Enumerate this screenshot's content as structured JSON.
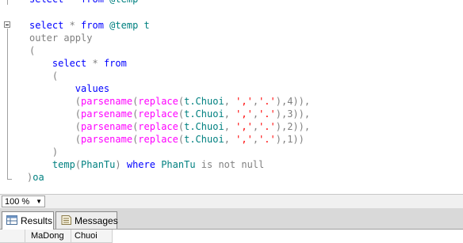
{
  "editor": {
    "lines": [
      {
        "indent": "",
        "tokens": [
          {
            "t": "select",
            "c": "kw"
          },
          {
            "t": " * ",
            "c": "gr"
          },
          {
            "t": "from",
            "c": "kw"
          },
          {
            "t": " @temp",
            "c": "tl"
          }
        ]
      },
      {
        "indent": "",
        "tokens": [
          {
            "t": "select",
            "c": "kw"
          },
          {
            "t": " * ",
            "c": "gr"
          },
          {
            "t": "from",
            "c": "kw"
          },
          {
            "t": " @temp t",
            "c": "tl"
          }
        ]
      },
      {
        "indent": "",
        "tokens": [
          {
            "t": "outer apply",
            "c": "gr"
          }
        ]
      },
      {
        "indent": "",
        "tokens": [
          {
            "t": "(",
            "c": "gr"
          }
        ]
      },
      {
        "indent": "    ",
        "tokens": [
          {
            "t": "select",
            "c": "kw"
          },
          {
            "t": " * ",
            "c": "gr"
          },
          {
            "t": "from",
            "c": "kw"
          }
        ]
      },
      {
        "indent": "    ",
        "tokens": [
          {
            "t": "(",
            "c": "gr"
          }
        ]
      },
      {
        "indent": "        ",
        "tokens": [
          {
            "t": "values",
            "c": "kw"
          }
        ]
      },
      {
        "indent": "        ",
        "tokens": [
          {
            "t": "(",
            "c": "gr"
          },
          {
            "t": "parsename",
            "c": "fn"
          },
          {
            "t": "(",
            "c": "gr"
          },
          {
            "t": "replace",
            "c": "fn"
          },
          {
            "t": "(",
            "c": "gr"
          },
          {
            "t": "t.Chuoi",
            "c": "tl"
          },
          {
            "t": ", ",
            "c": "gr"
          },
          {
            "t": "','",
            "c": "st"
          },
          {
            "t": ",",
            "c": "gr"
          },
          {
            "t": "'.'",
            "c": "st"
          },
          {
            "t": "),4)),",
            "c": "gr"
          }
        ]
      },
      {
        "indent": "        ",
        "tokens": [
          {
            "t": "(",
            "c": "gr"
          },
          {
            "t": "parsename",
            "c": "fn"
          },
          {
            "t": "(",
            "c": "gr"
          },
          {
            "t": "replace",
            "c": "fn"
          },
          {
            "t": "(",
            "c": "gr"
          },
          {
            "t": "t.Chuoi",
            "c": "tl"
          },
          {
            "t": ", ",
            "c": "gr"
          },
          {
            "t": "','",
            "c": "st"
          },
          {
            "t": ",",
            "c": "gr"
          },
          {
            "t": "'.'",
            "c": "st"
          },
          {
            "t": "),3)),",
            "c": "gr"
          }
        ]
      },
      {
        "indent": "        ",
        "tokens": [
          {
            "t": "(",
            "c": "gr"
          },
          {
            "t": "parsename",
            "c": "fn"
          },
          {
            "t": "(",
            "c": "gr"
          },
          {
            "t": "replace",
            "c": "fn"
          },
          {
            "t": "(",
            "c": "gr"
          },
          {
            "t": "t.Chuoi",
            "c": "tl"
          },
          {
            "t": ", ",
            "c": "gr"
          },
          {
            "t": "','",
            "c": "st"
          },
          {
            "t": ",",
            "c": "gr"
          },
          {
            "t": "'.'",
            "c": "st"
          },
          {
            "t": "),2)),",
            "c": "gr"
          }
        ]
      },
      {
        "indent": "        ",
        "tokens": [
          {
            "t": "(",
            "c": "gr"
          },
          {
            "t": "parsename",
            "c": "fn"
          },
          {
            "t": "(",
            "c": "gr"
          },
          {
            "t": "replace",
            "c": "fn"
          },
          {
            "t": "(",
            "c": "gr"
          },
          {
            "t": "t.Chuoi",
            "c": "tl"
          },
          {
            "t": ", ",
            "c": "gr"
          },
          {
            "t": "','",
            "c": "st"
          },
          {
            "t": ",",
            "c": "gr"
          },
          {
            "t": "'.'",
            "c": "st"
          },
          {
            "t": "),1))",
            "c": "gr"
          }
        ]
      },
      {
        "indent": "    ",
        "tokens": [
          {
            "t": ")",
            "c": "gr"
          }
        ]
      },
      {
        "indent": "    ",
        "tokens": [
          {
            "t": "temp",
            "c": "tl"
          },
          {
            "t": "(",
            "c": "gr"
          },
          {
            "t": "PhanTu",
            "c": "tl"
          },
          {
            "t": ") ",
            "c": "gr"
          },
          {
            "t": "where",
            "c": "kw"
          },
          {
            "t": " PhanTu ",
            "c": "tl"
          },
          {
            "t": "is not null",
            "c": "gr"
          }
        ]
      },
      {
        "indent": "",
        "tokens": [
          {
            "t": ")",
            "c": "gr"
          },
          {
            "t": "oa",
            "c": "tl"
          }
        ]
      }
    ]
  },
  "zoom": {
    "value": "100 %"
  },
  "tabs": [
    {
      "label": "Results",
      "icon": "results-grid-icon"
    },
    {
      "label": "Messages",
      "icon": "messages-icon"
    }
  ],
  "results": {
    "columns": [
      "MaDong",
      "Chuoi"
    ]
  },
  "colors": {
    "keyword": "#0000ff",
    "gray": "#808080",
    "function": "#ff00ff",
    "string": "#ff0000",
    "identifier": "#008080"
  }
}
